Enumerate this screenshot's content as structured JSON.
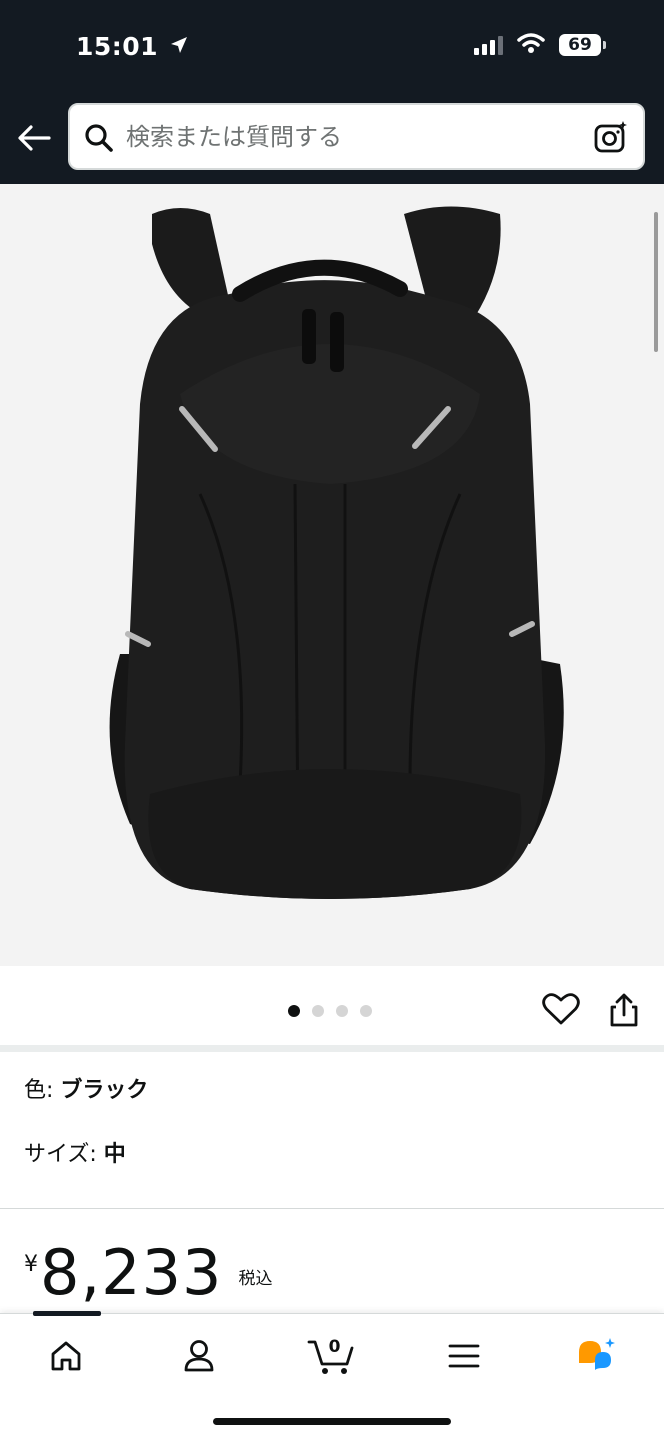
{
  "status_bar": {
    "time": "15:01",
    "battery": "69"
  },
  "search": {
    "placeholder": "検索または質問する"
  },
  "product": {
    "image_alt": "ブラック バックパック",
    "carousel": {
      "total": 4,
      "active": 1
    }
  },
  "variations": {
    "color_label": "色: ",
    "color_value": "ブラック",
    "size_label": "サイズ: ",
    "size_value": "中"
  },
  "price": {
    "symbol": "¥",
    "amount": "8,233",
    "tax_note": "税込"
  },
  "bottom_nav": {
    "cart_count": "0",
    "items": [
      "home-icon",
      "account-icon",
      "cart-icon",
      "menu-icon",
      "rufus-icon"
    ]
  },
  "colors": {
    "header_bg": "#131a22",
    "image_bg": "#f3f3f3",
    "rufus_orange": "#ff9900",
    "rufus_blue": "#1a98ff"
  }
}
